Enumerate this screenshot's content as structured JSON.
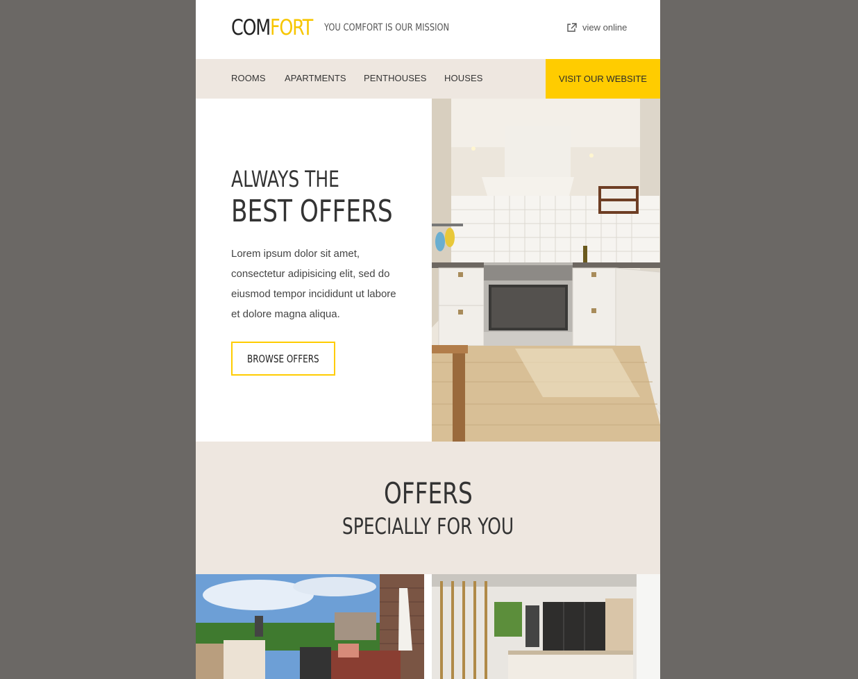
{
  "header": {
    "logo_part1": "COM",
    "logo_part2": "FORT",
    "tagline": "YOU COMFORT IS OUR MISSION",
    "view_online": "view online",
    "view_online_icon": "external-link-icon"
  },
  "nav": {
    "items": [
      {
        "label": "ROOMS"
      },
      {
        "label": "APARTMENTS"
      },
      {
        "label": "PENTHOUSES"
      },
      {
        "label": "HOUSES"
      }
    ],
    "cta": "VISIT OUR WEBSITE"
  },
  "hero": {
    "line1": "ALWAYS THE",
    "line2": "BEST OFFERS",
    "text": "Lorem ipsum dolor sit amet, consectetur adipisicing elit, sed do eiusmod tempor incididunt ut labore et dolore magna aliqua.",
    "button": "BROWSE OFFERS"
  },
  "offers": {
    "title": "OFFERS",
    "subtitle": "SPECIALLY FOR YOU"
  },
  "colors": {
    "accent": "#ffcc00",
    "background": "#6b6865",
    "panel": "#eee7e0"
  }
}
